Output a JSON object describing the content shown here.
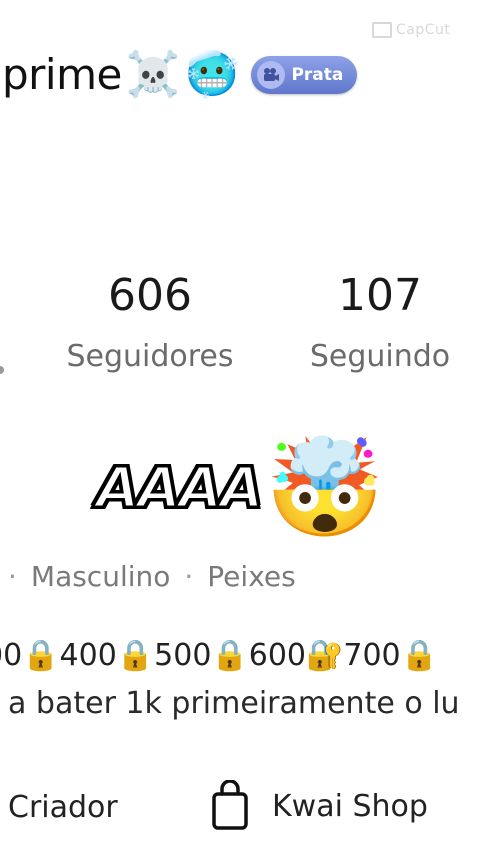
{
  "watermark": {
    "text": "CapCut"
  },
  "profile": {
    "name": "prime",
    "emojis": [
      "☠️",
      "🥶"
    ],
    "badge": {
      "label": "Prata",
      "icon": "video-camera-icon"
    }
  },
  "stats": {
    "followers": {
      "count": "606",
      "label": "Seguidores"
    },
    "following": {
      "count": "107",
      "label": "Seguindo"
    }
  },
  "bio": {
    "title": "AAAA",
    "emoji": "🤯",
    "tags": [
      "·",
      "Masculino",
      "·",
      "Peixes"
    ],
    "progress": "00🔒400🔒500🔒600🔐700🔒",
    "description": "a bater 1k primeiramente o lu"
  },
  "bottom": {
    "creator_label": "Criador",
    "shop_label": "Kwai Shop",
    "shop_icon": "shopping-bag-icon"
  }
}
